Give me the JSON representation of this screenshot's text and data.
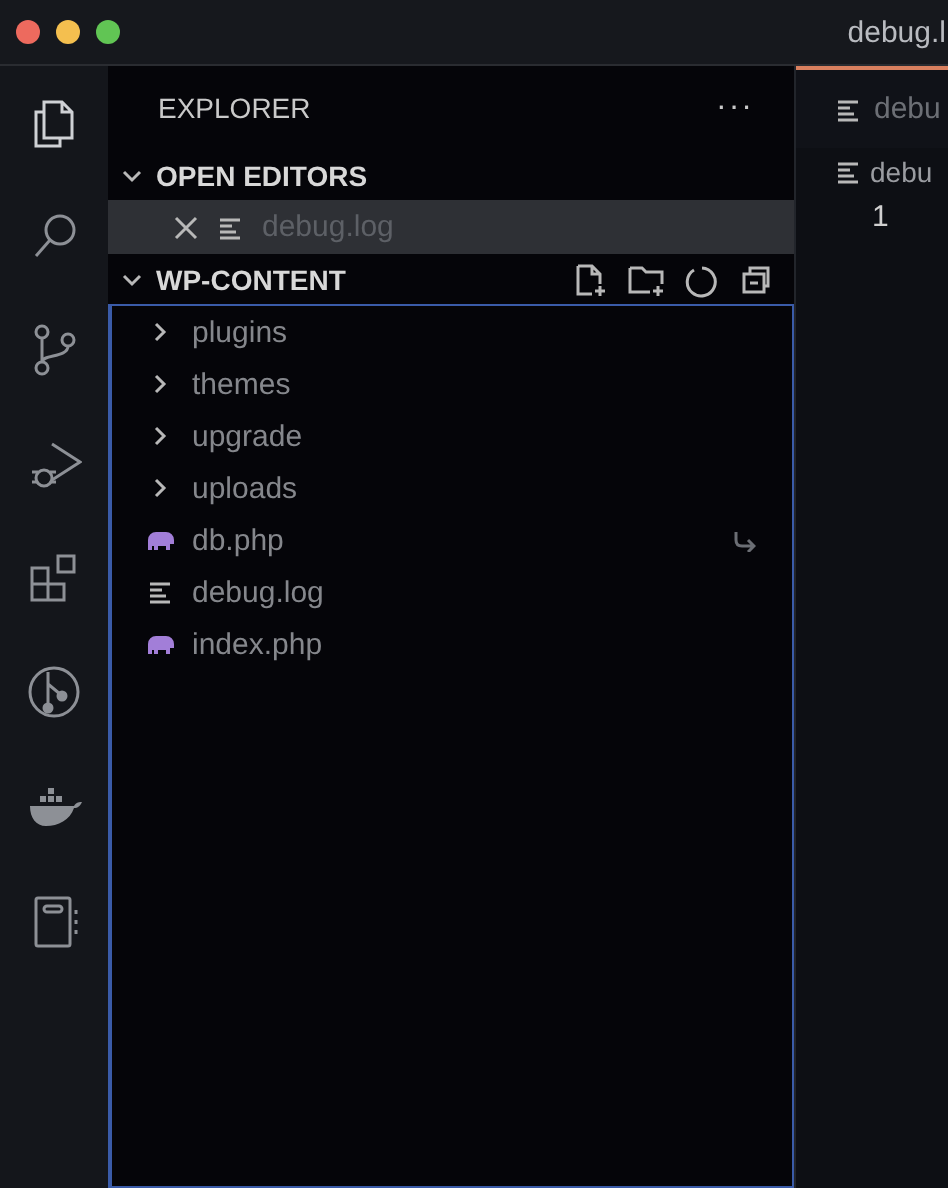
{
  "window": {
    "title": "debug.l"
  },
  "sidebar": {
    "title": "EXPLORER",
    "more": "···",
    "open_editors": {
      "title": "OPEN EDITORS",
      "expanded": true,
      "items": [
        {
          "name": "debug.log",
          "kind": "log",
          "selected": true
        }
      ]
    },
    "workspace": {
      "title": "WP-CONTENT",
      "expanded": true,
      "items": [
        {
          "name": "plugins",
          "kind": "folder",
          "expanded": false,
          "symlink": false
        },
        {
          "name": "themes",
          "kind": "folder",
          "expanded": false,
          "symlink": false
        },
        {
          "name": "upgrade",
          "kind": "folder",
          "expanded": false,
          "symlink": false
        },
        {
          "name": "uploads",
          "kind": "folder",
          "expanded": false,
          "symlink": false
        },
        {
          "name": "db.php",
          "kind": "php",
          "symlink": true
        },
        {
          "name": "debug.log",
          "kind": "log",
          "symlink": false
        },
        {
          "name": "index.php",
          "kind": "php",
          "symlink": false
        }
      ]
    }
  },
  "editor": {
    "tab": "debu",
    "breadcrumb": "debu",
    "line_numbers": [
      "1"
    ]
  }
}
